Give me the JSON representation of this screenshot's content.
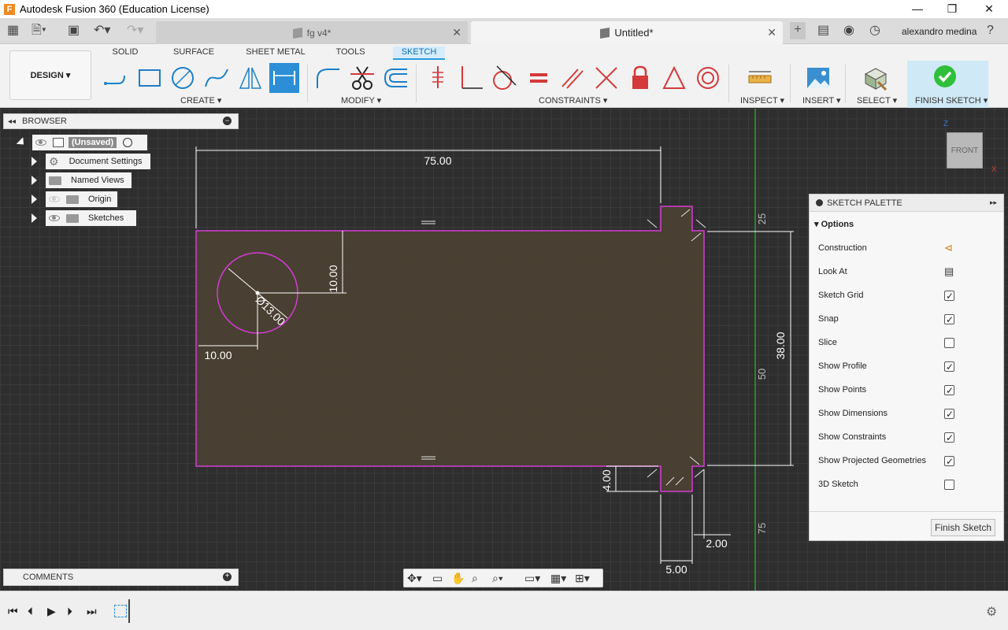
{
  "window": {
    "title": "Autodesk Fusion 360 (Education License)",
    "minimize": "—",
    "maximize": "❐",
    "close": "✕"
  },
  "tabs": [
    {
      "label": "fg v4*",
      "active": false
    },
    {
      "label": "Untitled*",
      "active": true
    }
  ],
  "user": {
    "name": "alexandro medina"
  },
  "toolbar": {
    "workspace": "DESIGN",
    "workspace_tabs": [
      "SOLID",
      "SURFACE",
      "SHEET METAL",
      "TOOLS",
      "SKETCH"
    ],
    "groups": {
      "create": "CREATE",
      "modify": "MODIFY",
      "constraints": "CONSTRAINTS",
      "inspect": "INSPECT",
      "insert": "INSERT",
      "select": "SELECT",
      "finish": "FINISH SKETCH"
    }
  },
  "browser": {
    "title": "BROWSER",
    "root": "(Unsaved)",
    "items": [
      "Document Settings",
      "Named Views",
      "Origin",
      "Sketches"
    ]
  },
  "comments": {
    "title": "COMMENTS"
  },
  "dimensions": {
    "width": "75.00",
    "circle_dia": "Ø13.00",
    "circle_top": "10.00",
    "circle_left": "10.00",
    "height_right": "38.00",
    "notch_height": "4.00",
    "notch_depth": "2.00",
    "notch_width": "5.00",
    "scale_25": "25",
    "scale_50": "50",
    "scale_75": "75"
  },
  "viewcube": {
    "face": "FRONT",
    "axis_z": "Z",
    "axis_x": "X"
  },
  "palette": {
    "title": "SKETCH PALETTE",
    "section": "Options",
    "options": [
      {
        "label": "Construction",
        "type": "icon"
      },
      {
        "label": "Look At",
        "type": "icon"
      },
      {
        "label": "Sketch Grid",
        "checked": true
      },
      {
        "label": "Snap",
        "checked": true
      },
      {
        "label": "Slice",
        "checked": false
      },
      {
        "label": "Show Profile",
        "checked": true
      },
      {
        "label": "Show Points",
        "checked": true
      },
      {
        "label": "Show Dimensions",
        "checked": true
      },
      {
        "label": "Show Constraints",
        "checked": true
      },
      {
        "label": "Show Projected Geometries",
        "checked": true
      },
      {
        "label": "3D Sketch",
        "checked": false
      }
    ],
    "finish_button": "Finish Sketch"
  },
  "colors": {
    "sketch_line": "#d63cd6",
    "profile_fill": "#5a4a3a",
    "accent": "#2b9ce0",
    "finish_check": "#2fbf3a"
  }
}
